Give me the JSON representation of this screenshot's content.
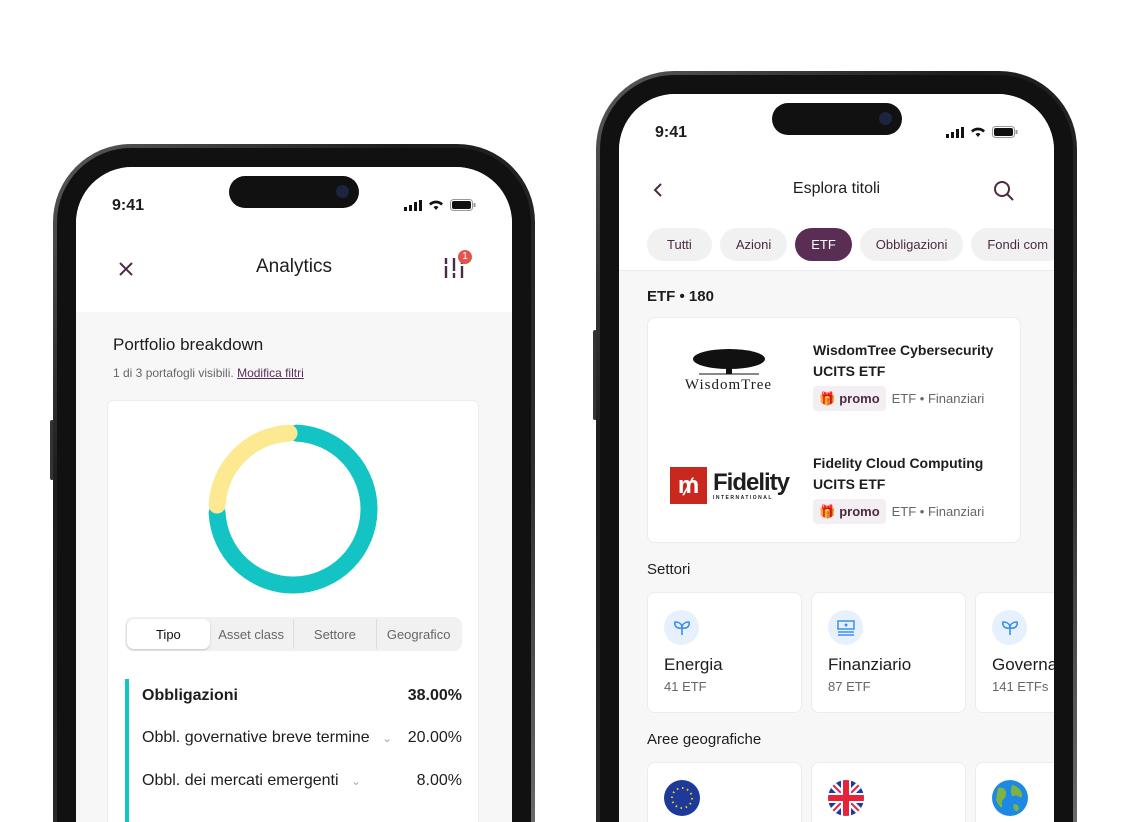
{
  "left_phone": {
    "status": {
      "time": "9:41"
    },
    "header": {
      "title": "Analytics",
      "filter_badge": "1",
      "close_icon": "close-icon",
      "filter_icon": "sliders-icon"
    },
    "section": {
      "title": "Portfolio breakdown",
      "subtitle": "1 di 3 portafogli visibili.",
      "link": "Modifica filtri"
    },
    "chart_data": {
      "type": "pie",
      "donut": true,
      "values": [
        75,
        25
      ],
      "colors": [
        "#14c4c4",
        "#fde992"
      ]
    },
    "segments": [
      {
        "label": "Tipo",
        "selected": true
      },
      {
        "label": "Asset class"
      },
      {
        "label": "Settore"
      },
      {
        "label": "Geografico"
      }
    ],
    "breakdown": {
      "accent": "#14c4c4",
      "group": {
        "label": "Obbligazioni",
        "value": "38.00%"
      },
      "items": [
        {
          "label": "Obbl. governative breve termine",
          "value": "20.00%"
        },
        {
          "label": "Obbl. dei mercati emergenti",
          "value": "8.00%"
        }
      ]
    }
  },
  "right_phone": {
    "status": {
      "time": "9:41"
    },
    "header": {
      "title": "Esplora titoli",
      "back_icon": "chevron-left-icon",
      "search_icon": "search-icon"
    },
    "chips": [
      {
        "label": "Tutti"
      },
      {
        "label": "Azioni"
      },
      {
        "label": "ETF",
        "selected": true
      },
      {
        "label": "Obbligazioni"
      },
      {
        "label": "Fondi com"
      }
    ],
    "accent": "#5a2d55",
    "list_title": "ETF • 180",
    "etfs": [
      {
        "name": "WisdomTree Cybersecurity",
        "name2": "UCITS ETF",
        "badge": "promo",
        "meta": "ETF • Finanziari",
        "logo": "WisdomTree"
      },
      {
        "name": "Fidelity Cloud Computing",
        "name2": "UCITS ETF",
        "badge": "promo",
        "meta": "ETF • Finanziari",
        "logo": "Fidelity",
        "logo_sub": "INTERNATIONAL"
      }
    ],
    "sectors_title": "Settori",
    "sectors": [
      {
        "name": "Energia",
        "count": "41 ETF",
        "icon": "sprout-icon"
      },
      {
        "name": "Finanziario",
        "count": "87 ETF",
        "icon": "banknote-icon"
      },
      {
        "name": "Governa",
        "count": "141 ETFs",
        "icon": "sprout-icon"
      }
    ],
    "geo_title": "Aree geografiche",
    "geo": [
      {
        "icon": "eu-flag-icon"
      },
      {
        "icon": "uk-flag-icon"
      },
      {
        "icon": "globe-icon"
      }
    ]
  }
}
